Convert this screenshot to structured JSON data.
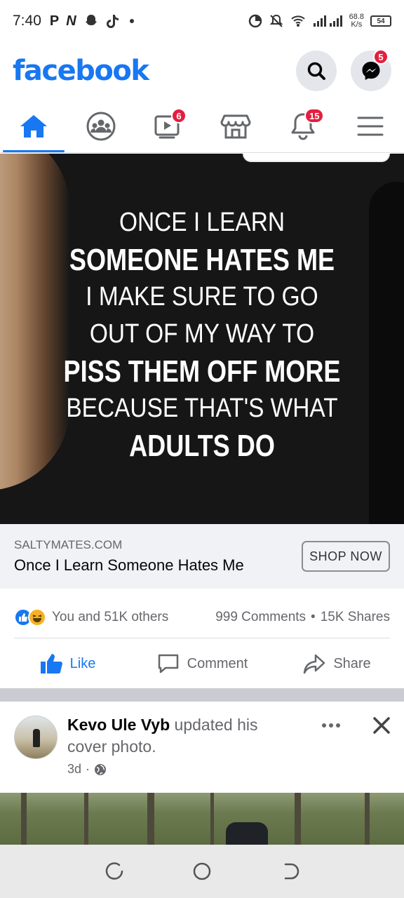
{
  "status_bar": {
    "time": "7:40",
    "app_icons": [
      "P",
      "N"
    ],
    "net_speed_value": "68.8",
    "net_speed_unit": "K/s",
    "battery": "54"
  },
  "header": {
    "logo": "facebook",
    "messenger_badge": "5"
  },
  "tabs": [
    {
      "name": "home",
      "icon": "home-icon",
      "active": true,
      "badge": ""
    },
    {
      "name": "groups",
      "icon": "groups-icon",
      "active": false,
      "badge": ""
    },
    {
      "name": "watch",
      "icon": "video-icon",
      "active": false,
      "badge": "6"
    },
    {
      "name": "marketplace",
      "icon": "store-icon",
      "active": false,
      "badge": ""
    },
    {
      "name": "notifications",
      "icon": "bell-icon",
      "active": false,
      "badge": "15"
    },
    {
      "name": "menu",
      "icon": "menu-icon",
      "active": false,
      "badge": ""
    }
  ],
  "post": {
    "image_text": {
      "line1": "ONCE I LEARN",
      "line2": "SOMEONE HATES ME",
      "line3": "I MAKE SURE TO GO",
      "line4": "OUT OF MY WAY TO",
      "line5": "PISS THEM OFF MORE",
      "line6": "BECAUSE THAT'S WHAT",
      "line7": "ADULTS DO"
    },
    "link": {
      "domain": "SALTYMATES.COM",
      "title": "Once I Learn Someone Hates Me",
      "cta": "SHOP NOW"
    },
    "reactions": {
      "summary": "You and 51K others",
      "comments": "999 Comments",
      "separator": "•",
      "shares": "15K Shares"
    },
    "actions": {
      "like": "Like",
      "comment": "Comment",
      "share": "Share"
    }
  },
  "post2": {
    "author": "Kevo Ule Vyb",
    "action": " updated his cover photo.",
    "time": "3d",
    "meta_separator": "·"
  },
  "colors": {
    "brand": "#1877f2",
    "badge": "#e41e3f",
    "secondary_text": "#65676b"
  }
}
